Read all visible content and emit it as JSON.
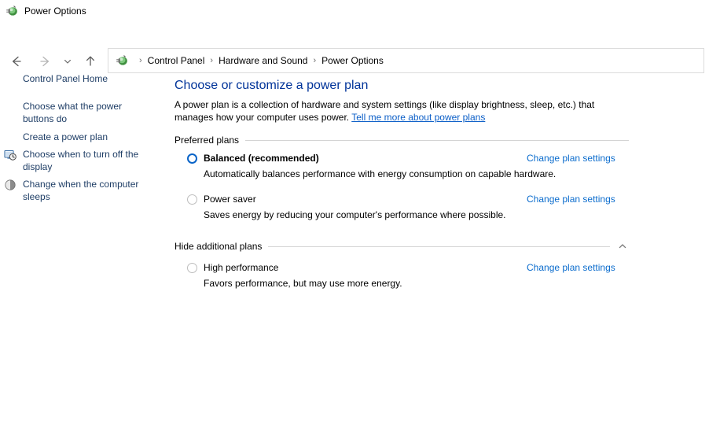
{
  "window": {
    "title": "Power Options",
    "icon": "power-plug-battery-icon"
  },
  "nav": {
    "back_icon": "back-arrow-icon",
    "forward_icon": "forward-arrow-icon",
    "recent_icon": "chevron-down-icon",
    "up_icon": "up-arrow-icon",
    "breadcrumb_icon": "power-plug-battery-icon",
    "separator": "›",
    "breadcrumbs": [
      "Control Panel",
      "Hardware and Sound",
      "Power Options"
    ]
  },
  "sidebar": {
    "items": [
      {
        "label": "Control Panel Home",
        "icon": null
      },
      {
        "label": "Choose what the power buttons do",
        "icon": null
      },
      {
        "label": "Create a power plan",
        "icon": null
      },
      {
        "label": "Choose when to turn off the display",
        "icon": "display-clock-icon"
      },
      {
        "label": "Change when the computer sleeps",
        "icon": "sleep-moon-icon"
      }
    ]
  },
  "main": {
    "title": "Choose or customize a power plan",
    "intro_text": "A power plan is a collection of hardware and system settings (like display brightness, sleep, etc.) that manages how your computer uses power. ",
    "intro_link": "Tell me more about power plans",
    "groups": [
      {
        "label": "Preferred plans",
        "chevron": null
      },
      {
        "label": "Hide additional plans",
        "chevron": "chevron-up-icon"
      }
    ],
    "plans": [
      {
        "name": "Balanced (recommended)",
        "description": "Automatically balances performance with energy consumption on capable hardware.",
        "action": "Change plan settings",
        "selected": true
      },
      {
        "name": "Power saver",
        "description": "Saves energy by reducing your computer's performance where possible.",
        "action": "Change plan settings",
        "selected": false
      },
      {
        "name": "High performance",
        "description": "Favors performance, but may use more energy.",
        "action": "Change plan settings",
        "selected": false
      }
    ]
  },
  "colors": {
    "heading": "#003399",
    "link": "#0b6ccd",
    "sidebar_link": "#1f3e66",
    "radio_selected": "#0a64c8",
    "rule": "#d4d4d4"
  }
}
